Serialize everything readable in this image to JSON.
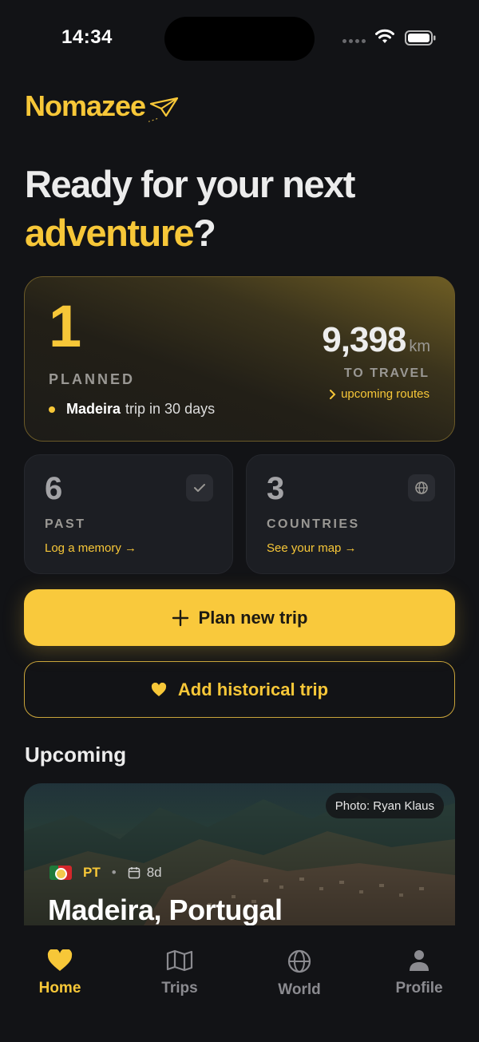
{
  "status_bar": {
    "time": "14:34"
  },
  "brand": {
    "name": "Nomazee"
  },
  "headline": {
    "line1": "Ready for your next",
    "accent": "adventure",
    "suffix": "?"
  },
  "planned_card": {
    "count": "1",
    "label": "PLANNED",
    "trip_bold": "Madeira",
    "trip_rest": "trip in 30 days",
    "distance": "9,398",
    "distance_unit": "km",
    "distance_label": "TO TRAVEL",
    "routes_link": "upcoming routes"
  },
  "stats": {
    "past": {
      "count": "6",
      "label": "PAST",
      "link": "Log a memory →"
    },
    "countries": {
      "count": "3",
      "label": "COUNTRIES",
      "link": "See your map →"
    }
  },
  "buttons": {
    "plan": "Plan new trip",
    "historical": "Add historical trip"
  },
  "upcoming": {
    "title": "Upcoming",
    "trip": {
      "photo_credit": "Photo: Ryan Klaus",
      "country_code": "PT",
      "duration": "8d",
      "name": "Madeira, Portugal"
    }
  },
  "tabs": [
    {
      "label": "Home",
      "icon": "heart-icon",
      "active": true
    },
    {
      "label": "Trips",
      "icon": "map-icon",
      "active": false
    },
    {
      "label": "World",
      "icon": "globe-icon",
      "active": false
    },
    {
      "label": "Profile",
      "icon": "person-icon",
      "active": false
    }
  ],
  "colors": {
    "accent": "#F7C738",
    "background": "#121316",
    "card": "#1c1e23"
  }
}
